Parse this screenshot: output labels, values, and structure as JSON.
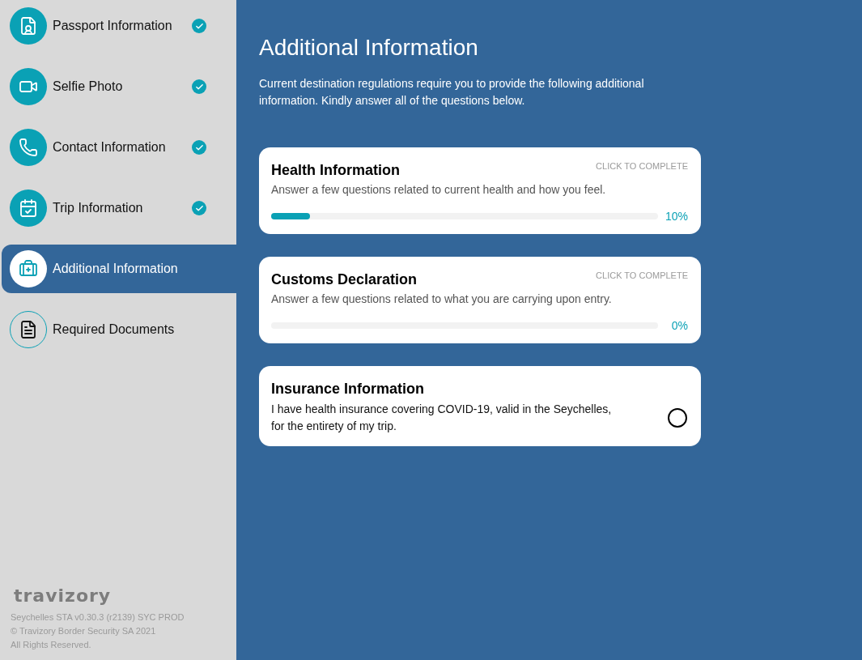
{
  "sidebar": {
    "items": [
      {
        "label": "Passport Information",
        "completed": true,
        "selected": false
      },
      {
        "label": "Selfie Photo",
        "completed": true,
        "selected": false
      },
      {
        "label": "Contact Information",
        "completed": true,
        "selected": false
      },
      {
        "label": "Trip Information",
        "completed": true,
        "selected": false
      },
      {
        "label": "Additional Information",
        "completed": false,
        "selected": true
      },
      {
        "label": "Required Documents",
        "completed": false,
        "selected": false
      }
    ],
    "logo": "travizory",
    "footer": [
      "Seychelles STA v0.30.3 (r2139) SYC PROD",
      "© Travizory Border Security SA 2021",
      "All Rights Reserved."
    ]
  },
  "main": {
    "title": "Additional Information",
    "intro": "Current destination regulations require you to provide the following additional information. Kindly answer all of the questions below.",
    "cards": [
      {
        "kind": "progress",
        "title": "Health Information",
        "action": "CLICK TO COMPLETE",
        "description": "Answer a few questions related to current health and how you feel.",
        "level": 0.1,
        "reading": "10%"
      },
      {
        "kind": "progress",
        "title": "Customs Declaration",
        "action": "CLICK TO COMPLETE",
        "description": "Answer a few questions related to what you are carrying upon entry.",
        "level": 0,
        "reading": "0%"
      },
      {
        "kind": "confirm",
        "title": "Insurance Information",
        "description": "I have health insurance covering COVID-19, valid in the Seychelles, for the entirety of my trip.",
        "checked": false
      }
    ]
  }
}
